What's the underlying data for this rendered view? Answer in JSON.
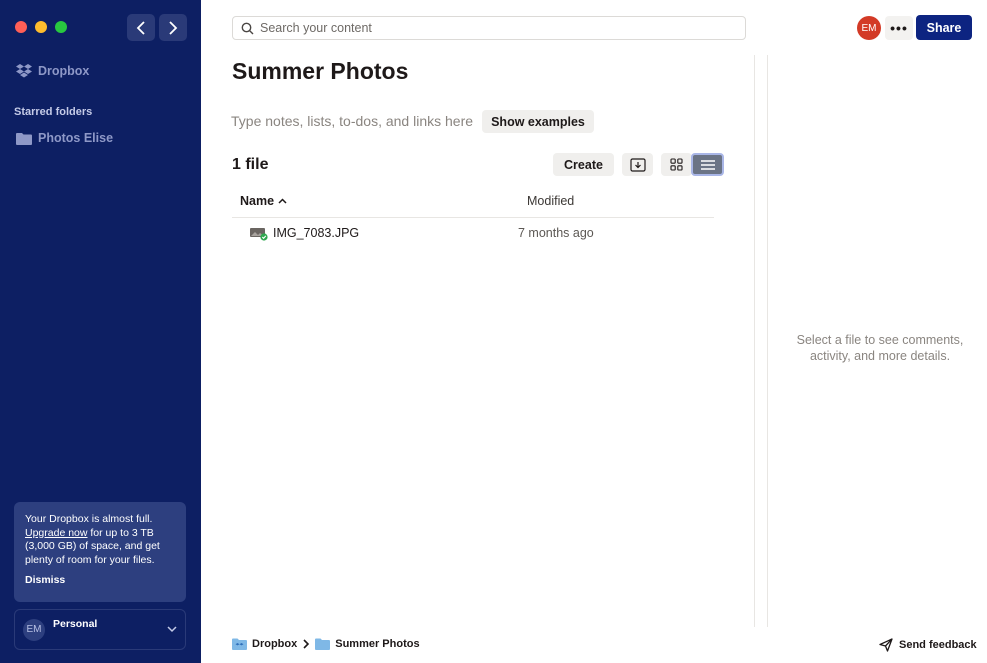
{
  "colors": {
    "sidebar_bg": "#0d1f63",
    "share_bg": "#0d2481",
    "avatar_bg": "#d33a26",
    "upgrade_card_bg": "#2d3f7f",
    "synced_badge": "#2fa84f"
  },
  "sidebar": {
    "brand": "Dropbox",
    "starred_heading": "Starred folders",
    "starred_items": [
      {
        "label": "Photos Elise",
        "icon": "folder-icon"
      }
    ],
    "upgrade": {
      "line1": "Your Dropbox is almost full.",
      "link": "Upgrade now",
      "rest": " for up to 3 TB (3,000 GB) of space, and get plenty of room for your files.",
      "dismiss": "Dismiss"
    },
    "account": {
      "initials": "EM",
      "name": "Personal"
    }
  },
  "header": {
    "search_placeholder": "Search your content",
    "avatar_initials": "EM",
    "more_label": "•••",
    "share_label": "Share"
  },
  "main": {
    "title": "Summer Photos",
    "notes_placeholder": "Type notes, lists, to-dos, and links here",
    "show_examples": "Show examples",
    "file_count": "1 file",
    "create_label": "Create",
    "view_buttons": [
      "preview-view-icon",
      "grid-view-icon",
      "list-view-icon"
    ],
    "active_view": "list",
    "columns": {
      "name": "Name",
      "modified": "Modified"
    },
    "files": [
      {
        "name": "IMG_7083.JPG",
        "modified": "7 months ago",
        "icon": "image-file-icon",
        "synced": true
      }
    ]
  },
  "details_panel": {
    "message": "Select a file to see comments, activity, and more details."
  },
  "footer": {
    "breadcrumb": [
      "Dropbox",
      "Summer Photos"
    ],
    "feedback": "Send feedback"
  }
}
